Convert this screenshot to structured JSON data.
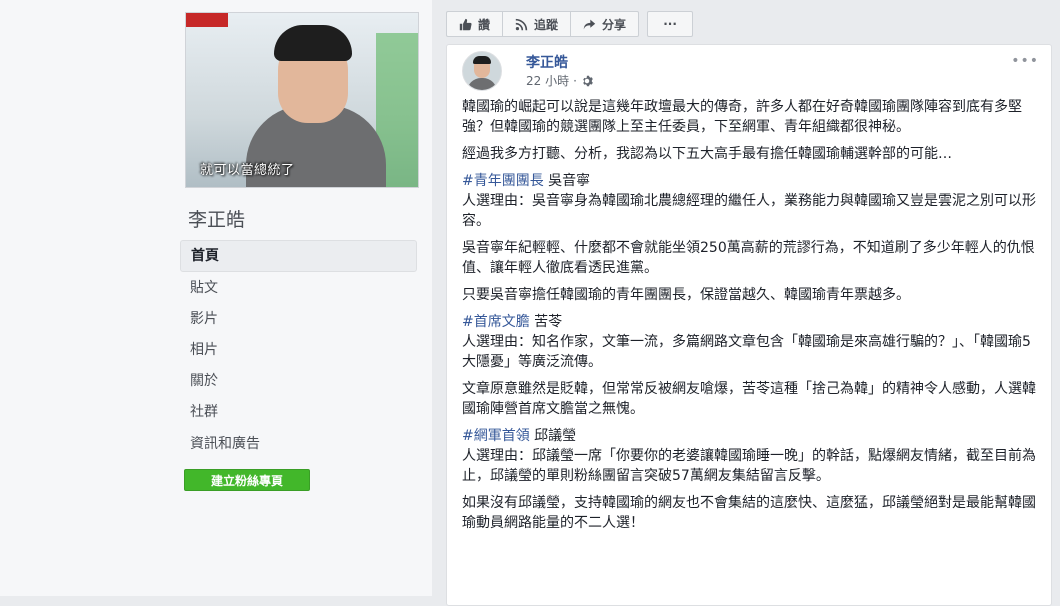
{
  "cover": {
    "caption": "就可以當總統了"
  },
  "page": {
    "name": "李正皓"
  },
  "nav": {
    "items": [
      {
        "label": "首頁",
        "active": true
      },
      {
        "label": "貼文",
        "active": false
      },
      {
        "label": "影片",
        "active": false
      },
      {
        "label": "相片",
        "active": false
      },
      {
        "label": "關於",
        "active": false
      },
      {
        "label": "社群",
        "active": false
      },
      {
        "label": "資訊和廣告",
        "active": false
      }
    ]
  },
  "create_page_button": "建立粉絲專頁",
  "actions": {
    "like": "讚",
    "follow": "追蹤",
    "share": "分享",
    "more": "···"
  },
  "post": {
    "author": "李正皓",
    "time": "22 小時",
    "dot": "·",
    "paragraphs": [
      {
        "text": "韓國瑜的崛起可以說是這幾年政壇最大的傳奇，許多人都在好奇韓國瑜團隊陣容到底有多堅強？但韓國瑜的競選團隊上至主任委員，下至網軍、青年組織都很神秘。"
      },
      {
        "text": "經過我多方打聽、分析，我認為以下五大高手最有擔任韓國瑜輔選幹部的可能…"
      },
      {
        "hashtag": "#青年團團長",
        "text": " 吳音寧\n人選理由：吳音寧身為韓國瑜北農總經理的繼任人，業務能力與韓國瑜又豈是雲泥之別可以形容。"
      },
      {
        "text": "吳音寧年紀輕輕、什麼都不會就能坐領250萬高薪的荒謬行為，不知道刷了多少年輕人的仇恨值、讓年輕人徹底看透民進黨。"
      },
      {
        "text": "只要吳音寧擔任韓國瑜的青年團團長，保證當越久、韓國瑜青年票越多。"
      },
      {
        "hashtag": "#首席文膽",
        "text": " 苦苓\n人選理由：知名作家，文筆一流，多篇網路文章包含「韓國瑜是來高雄行騙的？」、「韓國瑜5大隱憂」等廣泛流傳。"
      },
      {
        "text": "文章原意雖然是貶韓，但常常反被網友嗆爆，苦苓這種「捨己為韓」的精神令人感動，人選韓國瑜陣營首席文膽當之無愧。"
      },
      {
        "hashtag": "#網軍首領",
        "text": " 邱議瑩\n人選理由：邱議瑩一席「你要你的老婆讓韓國瑜睡一晚」的幹話，點爆網友情緒，截至目前為止，邱議瑩的單則粉絲團留言突破57萬網友集結留言反擊。"
      },
      {
        "text": "如果沒有邱議瑩，支持韓國瑜的網友也不會集結的這麼快、這麼猛，邱議瑩絕對是最能幫韓國瑜動員網路能量的不二人選！"
      }
    ]
  }
}
